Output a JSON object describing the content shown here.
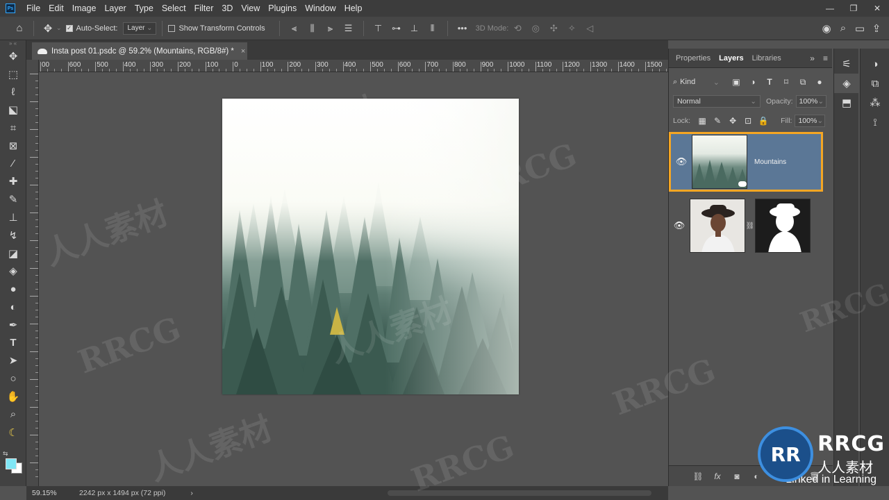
{
  "app": {
    "logo_text": "Ps",
    "menu": [
      "File",
      "Edit",
      "Image",
      "Layer",
      "Type",
      "Select",
      "Filter",
      "3D",
      "View",
      "Plugins",
      "Window",
      "Help"
    ],
    "window_controls": [
      "—",
      "❐",
      "✕"
    ]
  },
  "options_bar": {
    "auto_select_label": "Auto-Select:",
    "auto_select_target": "Layer",
    "show_transform_label": "Show Transform Controls",
    "mode_3d_label": "3D Mode:"
  },
  "document": {
    "tab_title": "Insta post 01.psdc @ 59.2% (Mountains, RGB/8#) *",
    "close_glyph": "×"
  },
  "ruler": {
    "labels": [
      "00",
      "600",
      "500",
      "400",
      "300",
      "200",
      "100",
      "0",
      "100",
      "200",
      "300",
      "400",
      "500",
      "600",
      "700",
      "800",
      "900",
      "1000",
      "1100",
      "1200",
      "1300",
      "1400",
      "1500",
      "1600"
    ]
  },
  "layers_panel": {
    "tabs": [
      "Properties",
      "Layers",
      "Libraries"
    ],
    "active_tab": "Layers",
    "kind_label": "Kind",
    "blend_mode": "Normal",
    "opacity_label": "Opacity:",
    "opacity_value": "100%",
    "lock_label": "Lock:",
    "fill_label": "Fill:",
    "fill_value": "100%",
    "layers": [
      {
        "name": "Mountains",
        "visible": true,
        "selected": true
      },
      {
        "name": "",
        "visible": true,
        "selected": false
      }
    ]
  },
  "status_bar": {
    "zoom": "59.15%",
    "doc_info": "2242 px x 1494 px (72 ppi)",
    "arrow": "›"
  },
  "watermark": {
    "latin": "RRCG",
    "cjk": "人人素材",
    "brand_main": "RRCG",
    "brand_sub": "人人素材",
    "badge": "RR",
    "learning": "Linked in Learning"
  },
  "colors": {
    "foreground_swatch": "#7fe6f5",
    "background_swatch": "#ffffff",
    "selection_outline": "#f5a623",
    "selected_layer_bg": "#5b7796"
  },
  "icons": {
    "home": "home-icon",
    "move": "move-icon",
    "search": "search-icon",
    "share": "share-icon"
  }
}
